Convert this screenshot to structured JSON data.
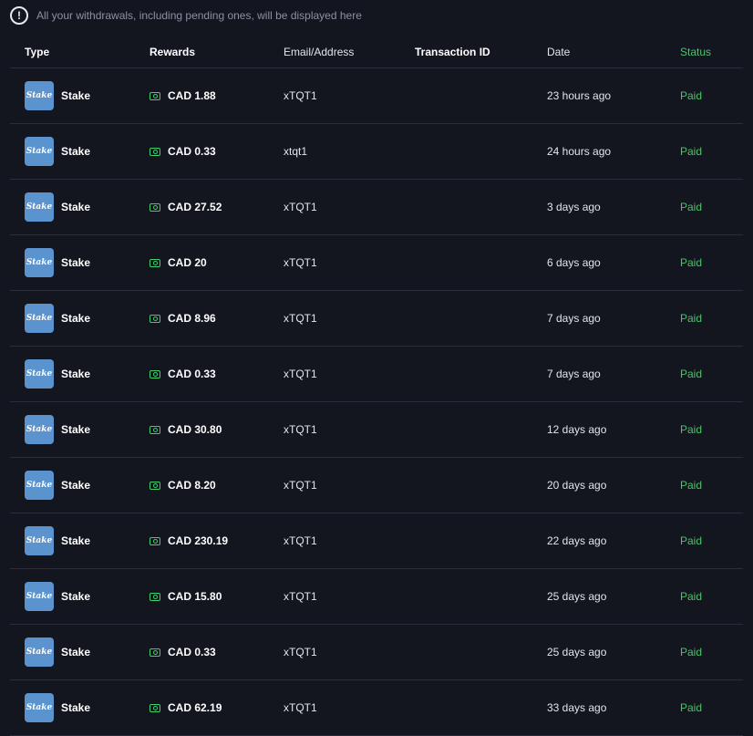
{
  "notice": {
    "text": "All your withdrawals, including pending ones, will be displayed here",
    "icon": "exclamation-circle-icon",
    "icon_glyph": "!"
  },
  "table": {
    "headers": {
      "type": "Type",
      "rewards": "Rewards",
      "email": "Email/Address",
      "txid": "Transaction ID",
      "date": "Date",
      "status": "Status"
    },
    "rows": [
      {
        "type": "Stake",
        "logo": "Stake",
        "reward": "CAD 1.88",
        "email": "xTQT1",
        "txid": "",
        "date": "23 hours ago",
        "status": "Paid"
      },
      {
        "type": "Stake",
        "logo": "Stake",
        "reward": "CAD 0.33",
        "email": "xtqt1",
        "txid": "",
        "date": "24 hours ago",
        "status": "Paid"
      },
      {
        "type": "Stake",
        "logo": "Stake",
        "reward": "CAD 27.52",
        "email": "xTQT1",
        "txid": "",
        "date": "3 days ago",
        "status": "Paid"
      },
      {
        "type": "Stake",
        "logo": "Stake",
        "reward": "CAD 20",
        "email": "xTQT1",
        "txid": "",
        "date": "6 days ago",
        "status": "Paid"
      },
      {
        "type": "Stake",
        "logo": "Stake",
        "reward": "CAD 8.96",
        "email": "xTQT1",
        "txid": "",
        "date": "7 days ago",
        "status": "Paid"
      },
      {
        "type": "Stake",
        "logo": "Stake",
        "reward": "CAD 0.33",
        "email": "xTQT1",
        "txid": "",
        "date": "7 days ago",
        "status": "Paid"
      },
      {
        "type": "Stake",
        "logo": "Stake",
        "reward": "CAD 30.80",
        "email": "xTQT1",
        "txid": "",
        "date": "12 days ago",
        "status": "Paid"
      },
      {
        "type": "Stake",
        "logo": "Stake",
        "reward": "CAD 8.20",
        "email": "xTQT1",
        "txid": "",
        "date": "20 days ago",
        "status": "Paid"
      },
      {
        "type": "Stake",
        "logo": "Stake",
        "reward": "CAD 230.19",
        "email": "xTQT1",
        "txid": "",
        "date": "22 days ago",
        "status": "Paid"
      },
      {
        "type": "Stake",
        "logo": "Stake",
        "reward": "CAD 15.80",
        "email": "xTQT1",
        "txid": "",
        "date": "25 days ago",
        "status": "Paid"
      },
      {
        "type": "Stake",
        "logo": "Stake",
        "reward": "CAD 0.33",
        "email": "xTQT1",
        "txid": "",
        "date": "25 days ago",
        "status": "Paid"
      },
      {
        "type": "Stake",
        "logo": "Stake",
        "reward": "CAD 62.19",
        "email": "xTQT1",
        "txid": "",
        "date": "33 days ago",
        "status": "Paid"
      }
    ]
  },
  "colors": {
    "background": "#13161f",
    "status_paid": "#4ec26b",
    "cash_icon": "#3ecf6e",
    "logo_bg": "#5b93cf"
  },
  "icons": {
    "reward": "cash-icon",
    "type_logo": "stake-logo-icon"
  }
}
